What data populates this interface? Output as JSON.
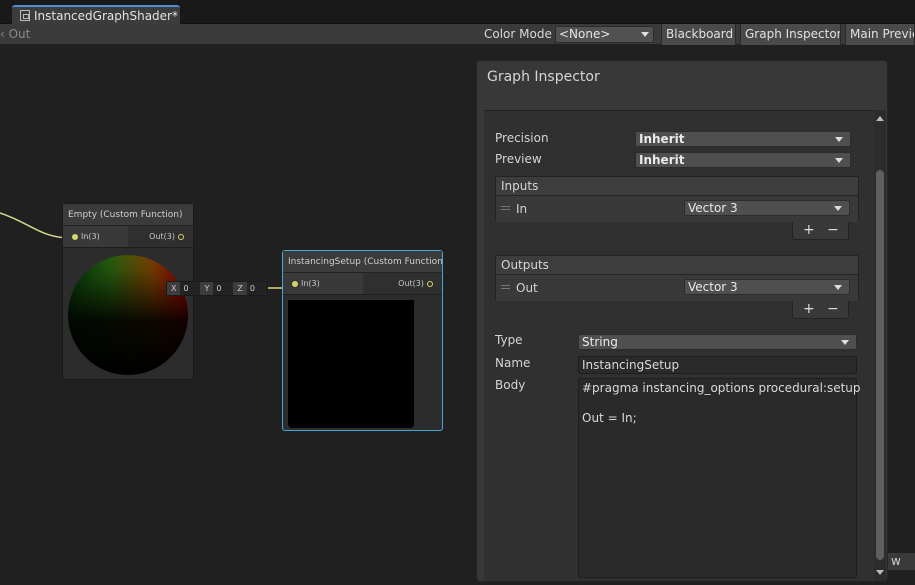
{
  "tab": {
    "title": "InstancedGraphShader*"
  },
  "toolbar": {
    "left_text": "‹ Out",
    "color_mode_label": "Color Mode",
    "color_mode_value": "<None>",
    "blackboard": "Blackboard",
    "graph_inspector": "Graph Inspector",
    "main_preview": "Main Preview"
  },
  "nodes": {
    "empty": {
      "title": "Empty (Custom Function)",
      "in_port": "In(3)",
      "out_port": "Out(3)"
    },
    "instancing": {
      "title": "InstancingSetup (Custom Function)",
      "in_port": "In(3)",
      "out_port": "Out(3)",
      "vector": {
        "x_label": "X",
        "x": "0",
        "y_label": "Y",
        "y": "0",
        "z_label": "Z",
        "z": "0"
      }
    }
  },
  "inspector": {
    "title": "Graph Inspector",
    "precision_label": "Precision",
    "precision_value": "Inherit",
    "preview_label": "Preview",
    "preview_value": "Inherit",
    "inputs": {
      "header": "Inputs",
      "row_name": "In",
      "row_type": "Vector 3"
    },
    "outputs": {
      "header": "Outputs",
      "row_name": "Out",
      "row_type": "Vector 3"
    },
    "plus": "+",
    "minus": "−",
    "type_label": "Type",
    "type_value": "String",
    "name_label": "Name",
    "name_value": "InstancingSetup",
    "body_label": "Body",
    "body_value": "#pragma instancing_options procedural:setup\n\nOut = In;"
  },
  "corner_tag": "w"
}
